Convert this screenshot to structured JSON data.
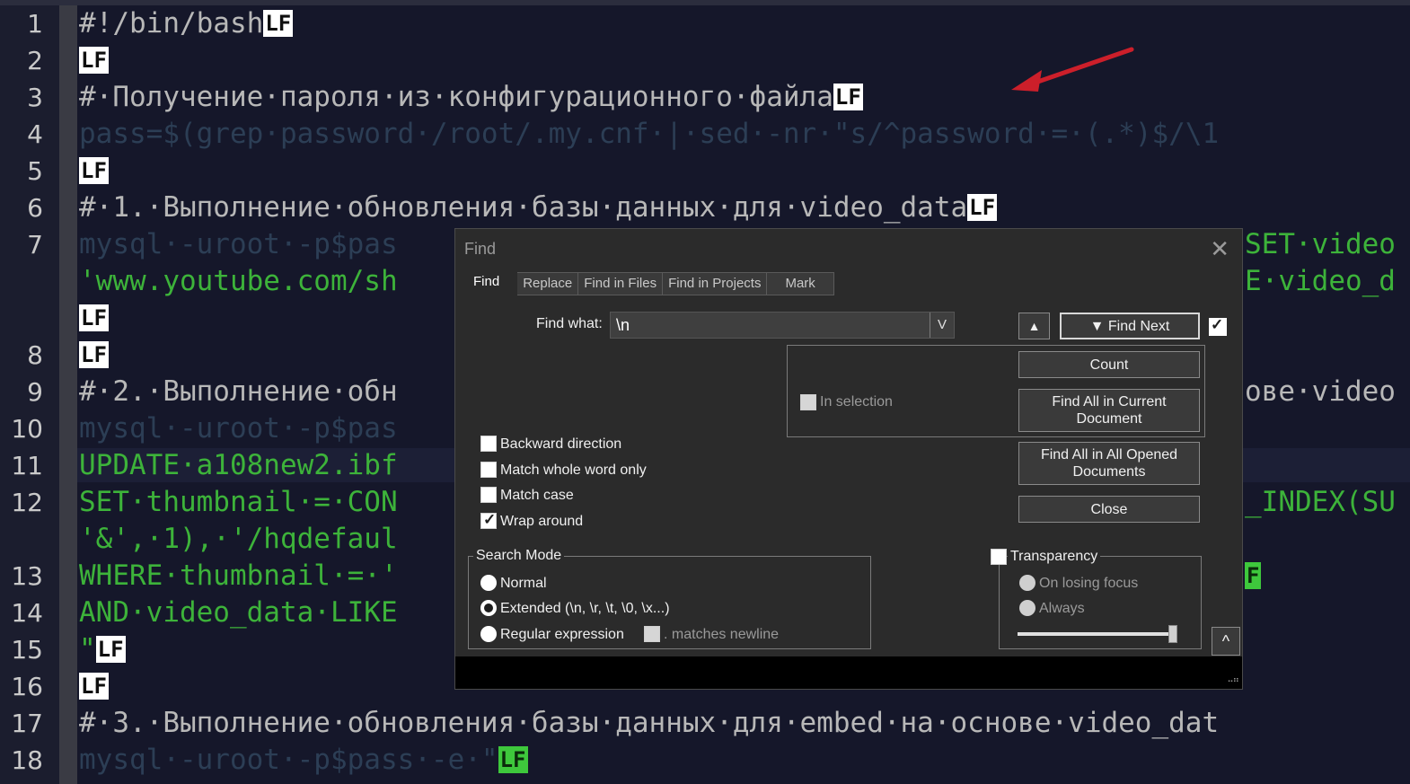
{
  "editor": {
    "line_numbers": [
      "1",
      "2",
      "3",
      "4",
      "5",
      "6",
      "7",
      "8",
      "9",
      "10",
      "11",
      "12",
      "13",
      "14",
      "15",
      "16",
      "17",
      "18"
    ],
    "eol_marker": "LF",
    "lines": {
      "l1_text": "#!/bin/bash",
      "l3_text": "#·Получение·пароля·из·конфигурационного·файла",
      "l4_text": "pass=$(grep·password·/root/.my.cnf·|·sed·-nr·\"s/^password·=·(.*)$/\\1",
      "l6_text": "#·1.·Выполнение·обновления·базы·данных·для·video_data",
      "l7_left": "mysql·-uroot·-p$pas",
      "l7_right": "SET·video",
      "l7b_left": "'www.youtube.com/sh",
      "l7b_right": "E·video_d",
      "l9_left": "#·2.·Выполнение·обн",
      "l9_right": "ове·video",
      "l10_left": "mysql·-uroot·-p$pas",
      "l11_left": "UPDATE·a108new2.ibf",
      "l12_left": "SET·thumbnail·=·CON",
      "l12_right": "_INDEX(SU",
      "l12b_left": "'&',·1),·'/hqdefaul",
      "l13_left": "WHERE·thumbnail·=·'",
      "l14_left": "AND·video_data·LIKE",
      "l15_text": "\"",
      "l17_text": "#·3.·Выполнение·обновления·базы·данных·для·embed·на·основе·video_dat",
      "l18_text": "mysql·-uroot·-p$pass·-e·\""
    }
  },
  "colors": {
    "editor_bg": "#15172a",
    "comment": "#b8b8b8",
    "string_green": "#3db33a",
    "annotation_arrow": "#cc1f2a"
  },
  "find_dialog": {
    "title": "Find",
    "close_icon": "close-icon",
    "tabs": [
      "Find",
      "Replace",
      "Find in Files",
      "Find in Projects",
      "Mark"
    ],
    "find_what_label": "Find what:",
    "find_what_value": "\\n",
    "dropdown_glyph": "V",
    "up_glyph": "▲",
    "find_next_label": "▼ Find Next",
    "count_label": "Count",
    "find_all_current_label": "Find All in Current Document",
    "find_all_opened_label": "Find All in All Opened Documents",
    "close_label": "Close",
    "in_selection_label": "In selection",
    "backward_label": "Backward direction",
    "whole_word_label": "Match whole word only",
    "match_case_label": "Match case",
    "wrap_around_label": "Wrap around",
    "wrap_around_checked": true,
    "search_mode_title": "Search Mode",
    "mode_normal": "Normal",
    "mode_extended": "Extended (\\n, \\r, \\t, \\0, \\x...)",
    "mode_regex": "Regular expression",
    "matches_newline": ". matches newline",
    "selected_mode": "Extended",
    "transparency_title": "Transparency",
    "on_losing_focus": "On losing focus",
    "always": "Always",
    "collapse_glyph": "^",
    "transparency_level": 1.0
  }
}
